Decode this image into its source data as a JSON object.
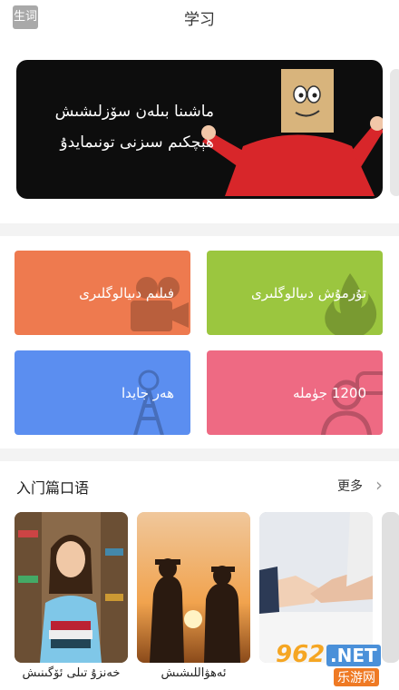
{
  "header": {
    "word_button": "生词",
    "title": "学习"
  },
  "banner": {
    "line1": "ماشىنا بىلەن سۆزلىشىش",
    "line2": "ھېچكىم سىزنى تونىمايدۇ"
  },
  "cards": [
    {
      "label": "فىلىم دىيالوگلىرى",
      "color": "#ee7a4f",
      "icon": "movie-camera-icon"
    },
    {
      "label": "تۇرمۇش دىيالوگلىرى",
      "color": "#9bc63f",
      "icon": "flame-icon"
    },
    {
      "label": "ھەر جايدا",
      "color": "#5b8ef0",
      "icon": "tower-icon"
    },
    {
      "label": "1200 جۈملە",
      "color": "#ee6a83",
      "icon": "people-chat-icon"
    }
  ],
  "section": {
    "title": "入门篇口语",
    "more": "更多"
  },
  "thumbnails": [
    {
      "label": "خەنزۇ تىلى ئۆگىنىش"
    },
    {
      "label": "ئەھۋاللىشىش"
    },
    {
      "label": ""
    }
  ],
  "watermark": {
    "num": "962",
    "net": ".NET",
    "cn": "乐游网"
  }
}
